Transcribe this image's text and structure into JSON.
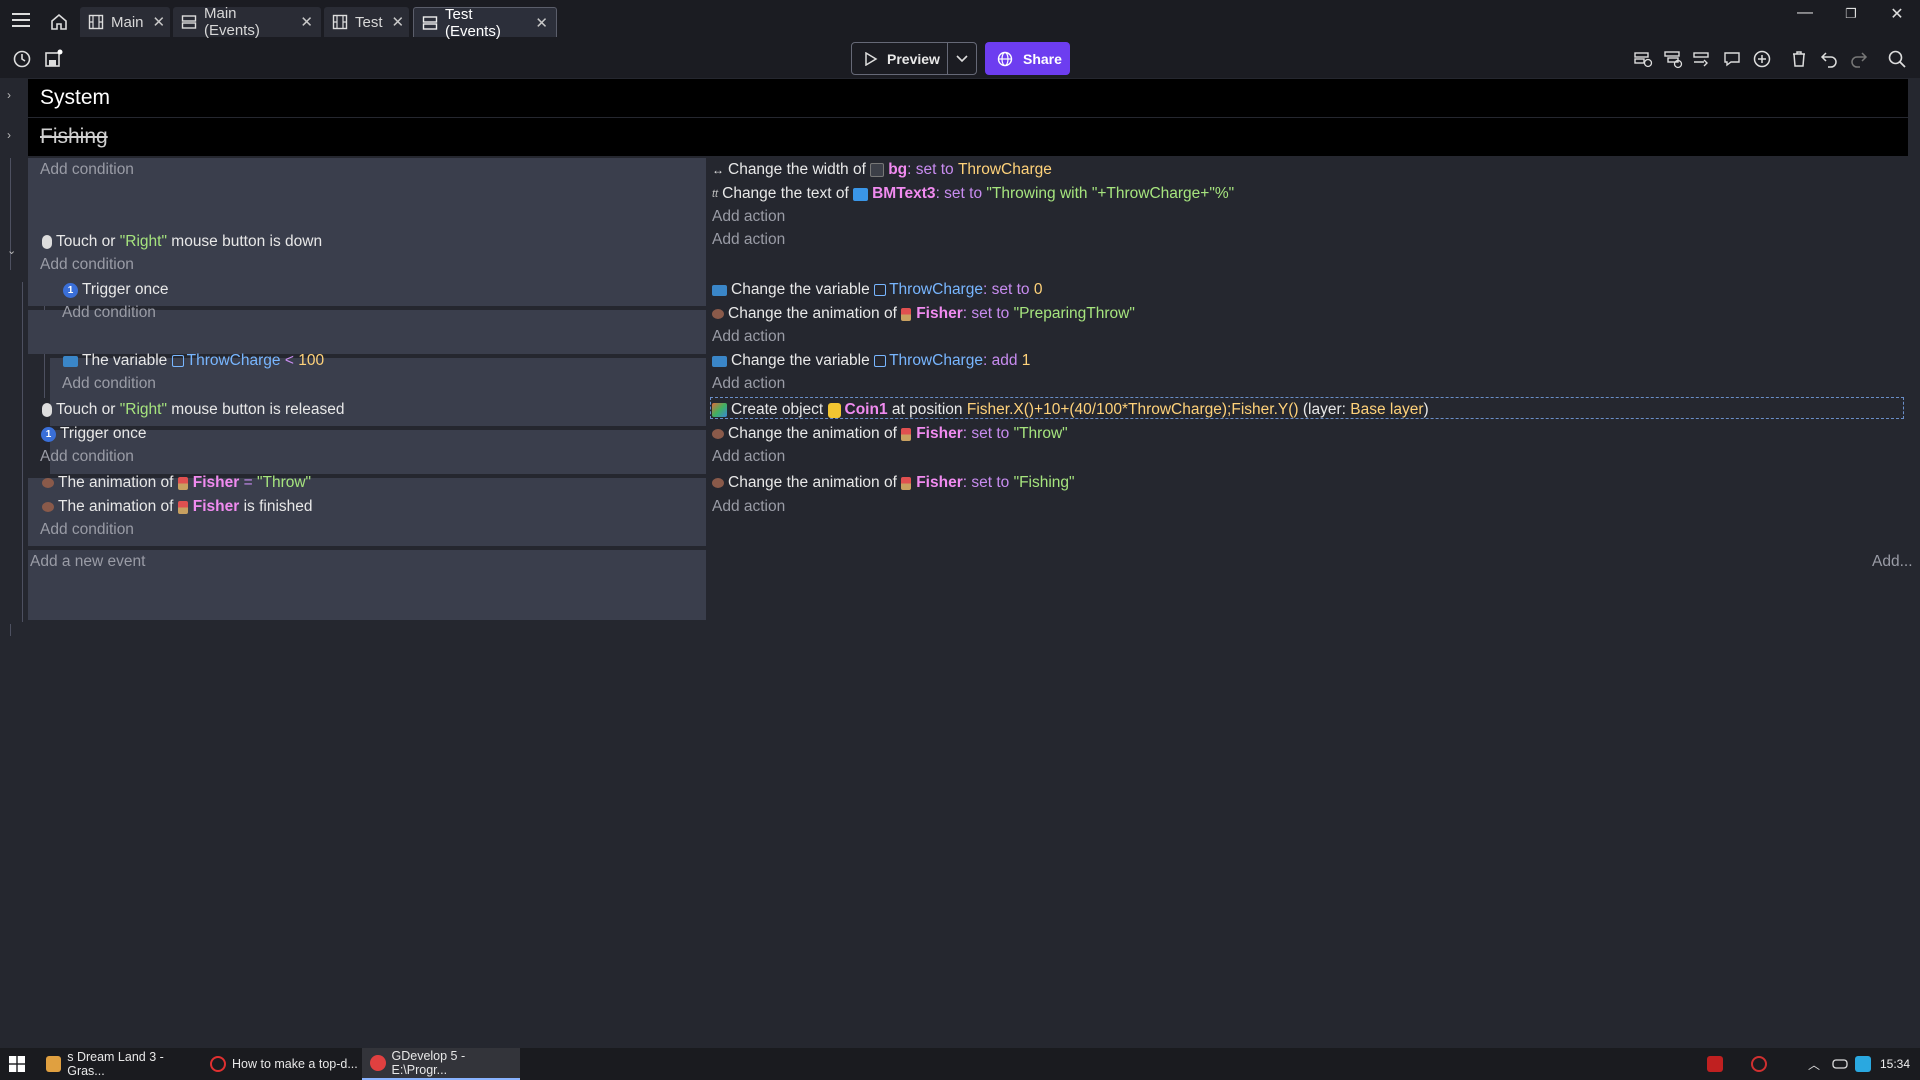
{
  "tabs": [
    {
      "label": "Main",
      "icon": "scene-icon"
    },
    {
      "label": "Main (Events)",
      "icon": "events-icon"
    },
    {
      "label": "Test",
      "icon": "scene-icon"
    },
    {
      "label": "Test (Events)",
      "icon": "events-icon",
      "active": true
    }
  ],
  "toolbar": {
    "preview_label": "Preview",
    "share_label": "Share"
  },
  "groups": {
    "system": "System",
    "fishing": "Fishing"
  },
  "labels": {
    "add_condition": "Add condition",
    "add_action": "Add action",
    "add_new_event": "Add a new event",
    "add_menu": "Add..."
  },
  "events": {
    "e1": {
      "a1": {
        "pre": "Change the width of",
        "obj": "bg",
        "mid": ": set to",
        "val": "ThrowCharge"
      },
      "a2": {
        "pre": "Change the text of",
        "obj": "BMText3",
        "mid": ": set to",
        "val": "\"Throwing with \"+ThrowCharge+\"%\""
      }
    },
    "e2": {
      "c1": {
        "pre": "Touch or",
        "str": "\"Right\"",
        "post": "mouse button is down"
      }
    },
    "e3": {
      "c1": "Trigger once",
      "a1": {
        "pre": "Change the variable",
        "var": "ThrowCharge",
        "mid": ": set to",
        "val": "0"
      },
      "a2": {
        "pre": "Change the animation of",
        "obj": "Fisher",
        "mid": ": set to",
        "val": "\"PreparingThrow\""
      }
    },
    "e4": {
      "c1": {
        "pre": "The variable",
        "var": "ThrowCharge",
        "op": "<",
        "val": "100"
      },
      "a1": {
        "pre": "Change the variable",
        "var": "ThrowCharge",
        "mid": ": add",
        "val": "1"
      }
    },
    "e5": {
      "c1": {
        "pre": "Touch or",
        "str": "\"Right\"",
        "post": "mouse button is released"
      },
      "c2": "Trigger once",
      "a1": {
        "pre": "Create object",
        "obj": "Coin1",
        "mid": "at position",
        "val": "Fisher.X()+10+(40/100*ThrowCharge);Fisher.Y()",
        "layer_pre": "(layer:",
        "layer": "Base layer",
        "layer_post": ")"
      },
      "a2": {
        "pre": "Change the animation of",
        "obj": "Fisher",
        "mid": ": set to",
        "val": "\"Throw\""
      }
    },
    "e6": {
      "c1": {
        "pre": "The animation of",
        "obj": "Fisher",
        "op": "=",
        "val": "\"Throw\""
      },
      "c2": {
        "pre": "The animation of",
        "obj": "Fisher",
        "post": "is finished"
      },
      "a1": {
        "pre": "Change the animation of",
        "obj": "Fisher",
        "mid": ": set to",
        "val": "\"Fishing\""
      }
    }
  },
  "taskbar": [
    {
      "label": "s Dream Land 3 - Gras...",
      "color": "#e0a040"
    },
    {
      "label": "How to make a top-d...",
      "color": "#e03030"
    },
    {
      "label": "GDevelop 5 - E:\\Progr...",
      "color": "#e04040",
      "active": true
    }
  ],
  "clock": "15:34",
  "colors": {
    "accent": "#6d3df0",
    "string": "#a6e47e",
    "object": "#f18bf0",
    "variable": "#78b6ff",
    "expression": "#ffd27a"
  }
}
